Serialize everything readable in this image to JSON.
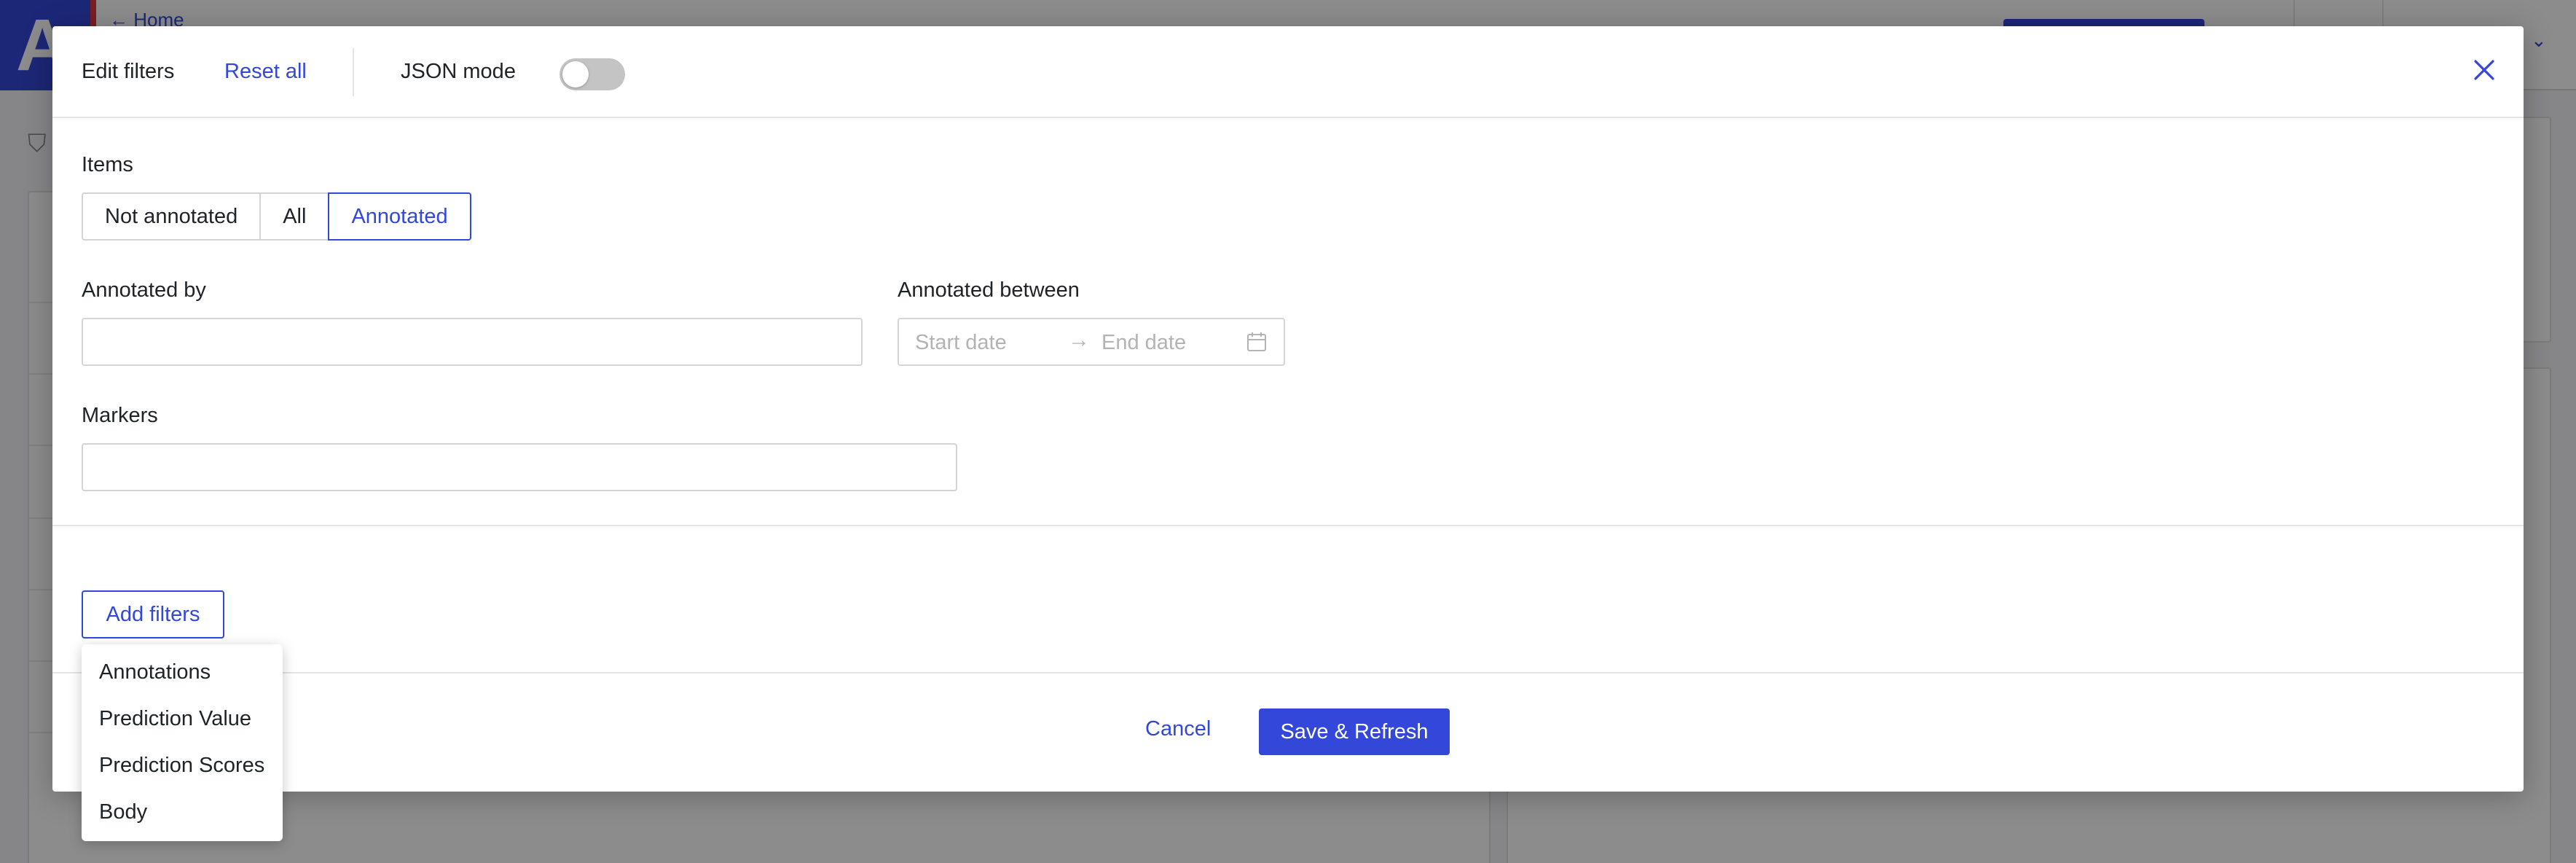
{
  "background": {
    "breadcrumb_home": "Home",
    "logo_letter": "A"
  },
  "modal": {
    "title": "Edit filters",
    "reset_all": "Reset all",
    "json_mode_label": "JSON mode",
    "json_mode_on": false,
    "items": {
      "label": "Items",
      "options": [
        "Not annotated",
        "All",
        "Annotated"
      ],
      "selected": "Annotated"
    },
    "annotated_by": {
      "label": "Annotated by",
      "value": ""
    },
    "annotated_between": {
      "label": "Annotated between",
      "start_placeholder": "Start date",
      "end_placeholder": "End date"
    },
    "markers": {
      "label": "Markers",
      "value": ""
    },
    "add_filters_label": "Add filters",
    "cancel_label": "Cancel",
    "save_label": "Save & Refresh"
  },
  "add_filters_menu": {
    "items": [
      "Annotations",
      "Prediction Value",
      "Prediction Scores",
      "Body"
    ]
  },
  "colors": {
    "accent": "#3347d9",
    "brand_red": "#e0383e"
  }
}
